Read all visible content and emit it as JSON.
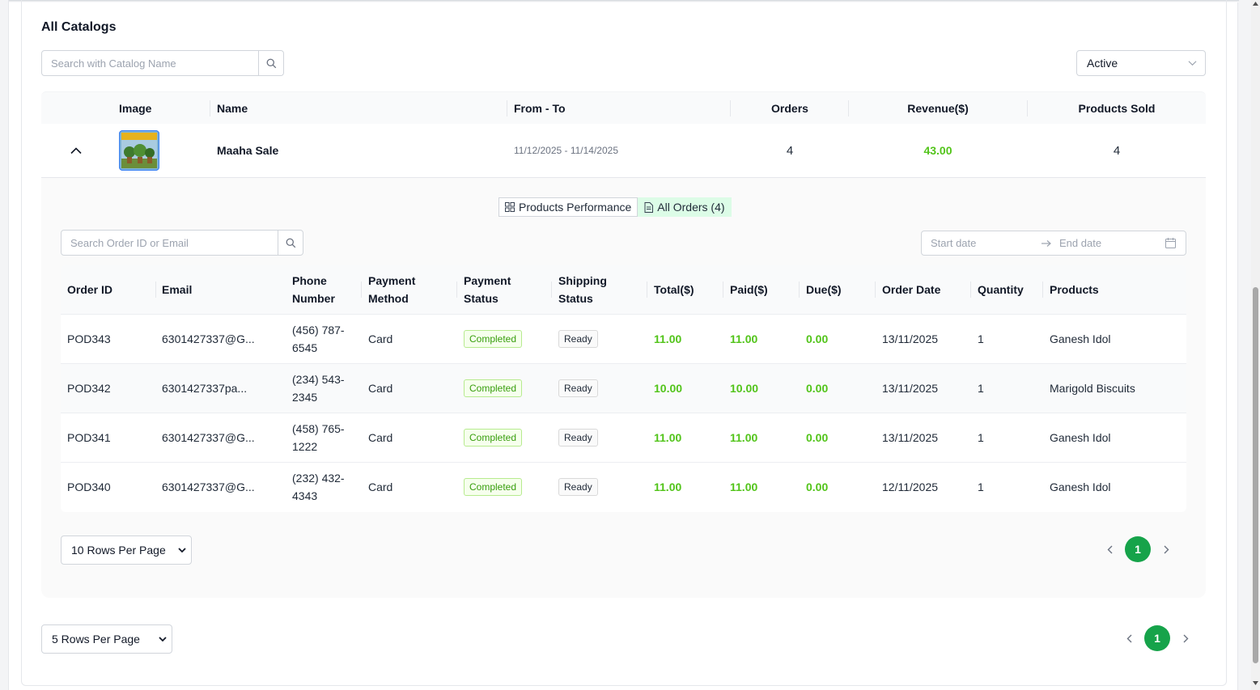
{
  "page": {
    "title": "All Catalogs"
  },
  "catalog_search": {
    "placeholder": "Search with Catalog Name"
  },
  "status_filter": {
    "value": "Active"
  },
  "catalog_table": {
    "headers": [
      "Image",
      "Name",
      "From - To",
      "Orders",
      "Revenue($)",
      "Products Sold"
    ],
    "rows": [
      {
        "name": "Maaha Sale",
        "from_to": "11/12/2025 - 11/14/2025",
        "orders": "4",
        "revenue": "43.00",
        "products_sold": "4"
      }
    ]
  },
  "tabs": [
    {
      "label": "Products Performance",
      "icon": "grid-icon"
    },
    {
      "label": "All Orders (4)",
      "icon": "document-icon"
    }
  ],
  "order_search": {
    "placeholder": "Search Order ID or Email"
  },
  "date_range": {
    "start_placeholder": "Start date",
    "end_placeholder": "End date"
  },
  "orders_table": {
    "headers": [
      "Order ID",
      "Email",
      "Phone Number",
      "Payment Method",
      "Payment Status",
      "Shipping Status",
      "Total($)",
      "Paid($)",
      "Due($)",
      "Order Date",
      "Quantity",
      "Products"
    ],
    "rows": [
      {
        "order_id": "POD343",
        "email": "6301427337@G...",
        "phone": "(456) 787-6545",
        "method": "Card",
        "pay_status": "Completed",
        "ship_status": "Ready",
        "total": "11.00",
        "paid": "11.00",
        "due": "0.00",
        "date": "13/11/2025",
        "qty": "1",
        "product": "Ganesh Idol"
      },
      {
        "order_id": "POD342",
        "email": "6301427337pa...",
        "phone": "(234) 543-2345",
        "method": "Card",
        "pay_status": "Completed",
        "ship_status": "Ready",
        "total": "10.00",
        "paid": "10.00",
        "due": "0.00",
        "date": "13/11/2025",
        "qty": "1",
        "product": "Marigold Biscuits"
      },
      {
        "order_id": "POD341",
        "email": "6301427337@G...",
        "phone": "(458) 765-1222",
        "method": "Card",
        "pay_status": "Completed",
        "ship_status": "Ready",
        "total": "11.00",
        "paid": "11.00",
        "due": "0.00",
        "date": "13/11/2025",
        "qty": "1",
        "product": "Ganesh Idol"
      },
      {
        "order_id": "POD340",
        "email": "6301427337@G...",
        "phone": "(232) 432-4343",
        "method": "Card",
        "pay_status": "Completed",
        "ship_status": "Ready",
        "total": "11.00",
        "paid": "11.00",
        "due": "0.00",
        "date": "12/11/2025",
        "qty": "1",
        "product": "Ganesh Idol"
      }
    ]
  },
  "orders_pagination": {
    "rows_per_page": "10 Rows Per Page",
    "page": "1"
  },
  "catalog_pagination": {
    "rows_per_page": "5 Rows Per Page",
    "page": "1"
  },
  "colors": {
    "accent": "#16a34a",
    "money": "#52c41a",
    "tab_active": "#dcfce7"
  }
}
